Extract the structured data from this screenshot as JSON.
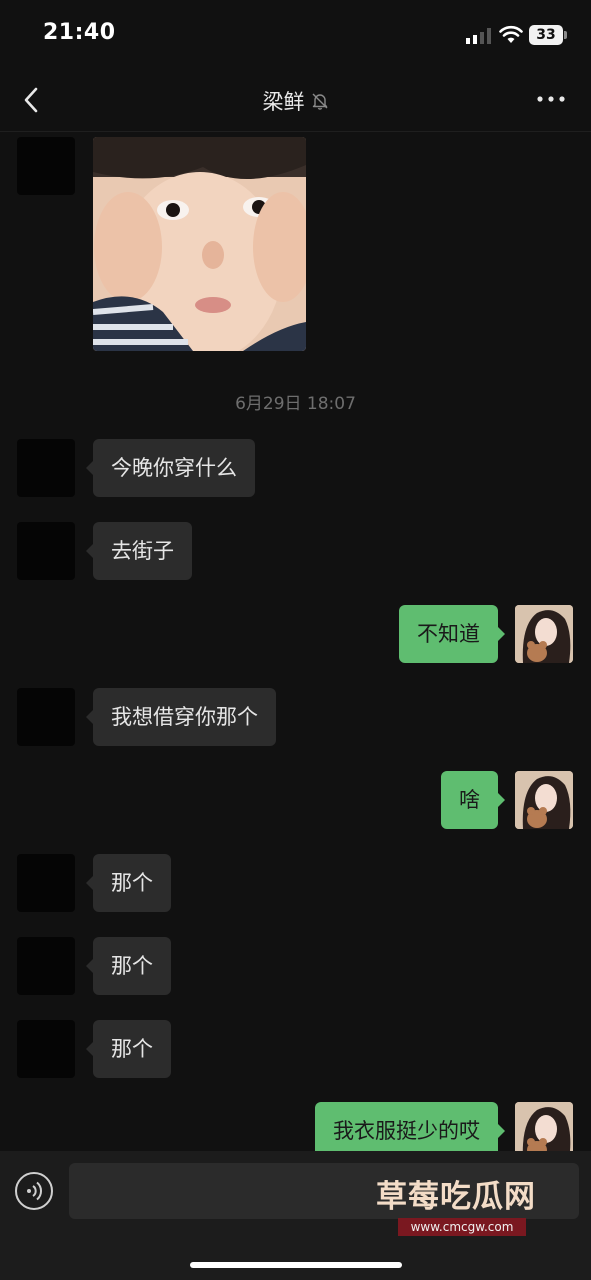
{
  "status_bar": {
    "time": "21:40",
    "battery": "33"
  },
  "nav": {
    "title": "梁鲜"
  },
  "timestamp": "6月29日 18:07",
  "messages": [
    {
      "text": "今晚你穿什么"
    },
    {
      "text": "去街子"
    },
    {
      "text": "不知道"
    },
    {
      "text": "我想借穿你那个"
    },
    {
      "text": "啥"
    },
    {
      "text": "那个"
    },
    {
      "text": "那个"
    },
    {
      "text": "那个"
    },
    {
      "text": "我衣服挺少的哎"
    }
  ],
  "watermark": {
    "name": "草莓吃瓜网",
    "url": "www.cmcgw.com"
  },
  "colors": {
    "background": "#111111",
    "incoming_bubble": "#2c2c2c",
    "outgoing_bubble": "#5fbd70",
    "watermark_banner": "#7a1820"
  },
  "icons": [
    "back-icon",
    "mute-icon",
    "more-icon",
    "signal-icon",
    "wifi-icon",
    "voice-icon"
  ]
}
